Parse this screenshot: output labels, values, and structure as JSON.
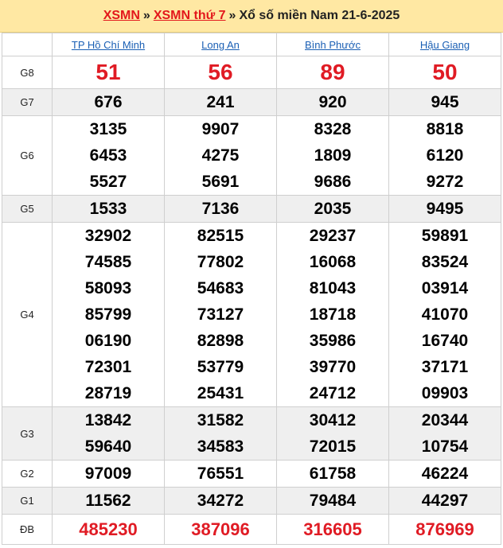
{
  "header": {
    "crumb1": "XSMN",
    "crumb2": "XSMN thứ 7",
    "sep": "»",
    "title": "Xổ số miền Nam 21-6-2025"
  },
  "colors": {
    "accent_red": "#e01b24",
    "link_blue": "#1a5fb4",
    "header_bg": "#ffe8a3"
  },
  "provinces": [
    "TP Hồ Chí Minh",
    "Long An",
    "Bình Phước",
    "Hậu Giang"
  ],
  "prizes": {
    "g8": {
      "label": "G8",
      "values": [
        "51",
        "56",
        "89",
        "50"
      ]
    },
    "g7": {
      "label": "G7",
      "values": [
        "676",
        "241",
        "920",
        "945"
      ]
    },
    "g6": {
      "label": "G6",
      "values": [
        [
          "3135",
          "6453",
          "5527"
        ],
        [
          "9907",
          "4275",
          "5691"
        ],
        [
          "8328",
          "1809",
          "9686"
        ],
        [
          "8818",
          "6120",
          "9272"
        ]
      ]
    },
    "g5": {
      "label": "G5",
      "values": [
        "1533",
        "7136",
        "2035",
        "9495"
      ]
    },
    "g4": {
      "label": "G4",
      "values": [
        [
          "32902",
          "74585",
          "58093",
          "85799",
          "06190",
          "72301",
          "28719"
        ],
        [
          "82515",
          "77802",
          "54683",
          "73127",
          "82898",
          "53779",
          "25431"
        ],
        [
          "29237",
          "16068",
          "81043",
          "18718",
          "35986",
          "39770",
          "24712"
        ],
        [
          "59891",
          "83524",
          "03914",
          "41070",
          "16740",
          "37171",
          "09903"
        ]
      ]
    },
    "g3": {
      "label": "G3",
      "values": [
        [
          "13842",
          "59640"
        ],
        [
          "31582",
          "34583"
        ],
        [
          "30412",
          "72015"
        ],
        [
          "20344",
          "10754"
        ]
      ]
    },
    "g2": {
      "label": "G2",
      "values": [
        "97009",
        "76551",
        "61758",
        "46224"
      ]
    },
    "g1": {
      "label": "G1",
      "values": [
        "11562",
        "34272",
        "79484",
        "44297"
      ]
    },
    "db": {
      "label": "ĐB",
      "values": [
        "485230",
        "387096",
        "316605",
        "876969"
      ]
    }
  }
}
